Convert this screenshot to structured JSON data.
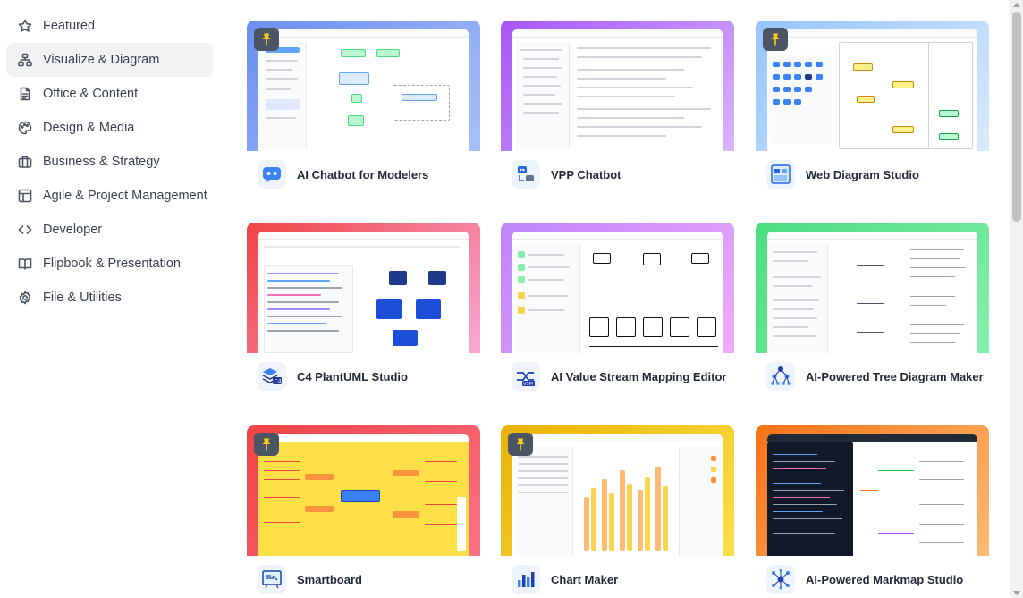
{
  "sidebar": {
    "items": [
      {
        "label": "Featured",
        "icon": "star-icon",
        "active": false
      },
      {
        "label": "Visualize & Diagram",
        "icon": "diagram-icon",
        "active": true
      },
      {
        "label": "Office & Content",
        "icon": "document-icon",
        "active": false
      },
      {
        "label": "Design & Media",
        "icon": "palette-icon",
        "active": false
      },
      {
        "label": "Business & Strategy",
        "icon": "briefcase-icon",
        "active": false
      },
      {
        "label": "Agile & Project Management",
        "icon": "board-icon",
        "active": false
      },
      {
        "label": "Developer",
        "icon": "code-icon",
        "active": false
      },
      {
        "label": "Flipbook & Presentation",
        "icon": "book-icon",
        "active": false
      },
      {
        "label": "File & Utilities",
        "icon": "gear-icon",
        "active": false
      }
    ]
  },
  "apps": [
    {
      "title": "AI Chatbot for Modelers",
      "icon": "chatbot-icon",
      "pinned": true,
      "gradient": [
        "#6b8ff0",
        "#a8c0f8"
      ]
    },
    {
      "title": "VPP Chatbot",
      "icon": "vpp-chatbot-icon",
      "pinned": false,
      "gradient": [
        "#a855f7",
        "#d8b4fe"
      ]
    },
    {
      "title": "Web Diagram Studio",
      "icon": "web-diagram-icon",
      "pinned": true,
      "gradient": [
        "#93c5fd",
        "#dbeafe"
      ]
    },
    {
      "title": "C4 PlantUML Studio",
      "icon": "c4-icon",
      "pinned": false,
      "gradient": [
        "#ef4444",
        "#f9a8d4"
      ]
    },
    {
      "title": "AI Value Stream Mapping Editor",
      "icon": "vsm-icon",
      "pinned": false,
      "gradient": [
        "#c084fc",
        "#f0abfc"
      ]
    },
    {
      "title": "AI-Powered Tree Diagram Maker",
      "icon": "tree-icon",
      "pinned": false,
      "gradient": [
        "#4ade80",
        "#86efac"
      ]
    },
    {
      "title": "Smartboard",
      "icon": "smartboard-icon",
      "pinned": true,
      "gradient": [
        "#ef4444",
        "#fb7185"
      ]
    },
    {
      "title": "Chart Maker",
      "icon": "chart-icon",
      "pinned": true,
      "gradient": [
        "#eab308",
        "#fde047"
      ]
    },
    {
      "title": "AI-Powered Markmap Studio",
      "icon": "markmap-icon",
      "pinned": false,
      "gradient": [
        "#f97316",
        "#fdba74"
      ]
    }
  ]
}
